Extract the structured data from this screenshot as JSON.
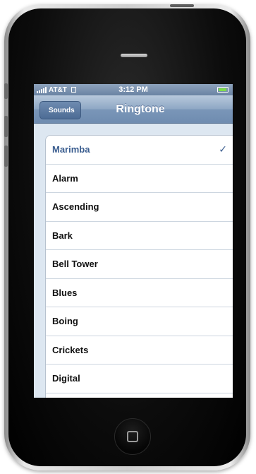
{
  "status_bar": {
    "carrier": "AT&T",
    "time": "3:12 PM",
    "signal_bars": 5,
    "battery_level": 0.9,
    "battery_color": "#7ddc4c"
  },
  "nav_bar": {
    "back_label": "Sounds",
    "title": "Ringtone"
  },
  "ringtones": [
    {
      "name": "Marimba",
      "selected": true
    },
    {
      "name": "Alarm",
      "selected": false
    },
    {
      "name": "Ascending",
      "selected": false
    },
    {
      "name": "Bark",
      "selected": false
    },
    {
      "name": "Bell Tower",
      "selected": false
    },
    {
      "name": "Blues",
      "selected": false
    },
    {
      "name": "Boing",
      "selected": false
    },
    {
      "name": "Crickets",
      "selected": false
    },
    {
      "name": "Digital",
      "selected": false
    }
  ],
  "checkmark": "✓",
  "colors": {
    "accent_text": "#3a5d8f",
    "nav_bar": "#7a96b8",
    "background": "#dde7f1"
  }
}
